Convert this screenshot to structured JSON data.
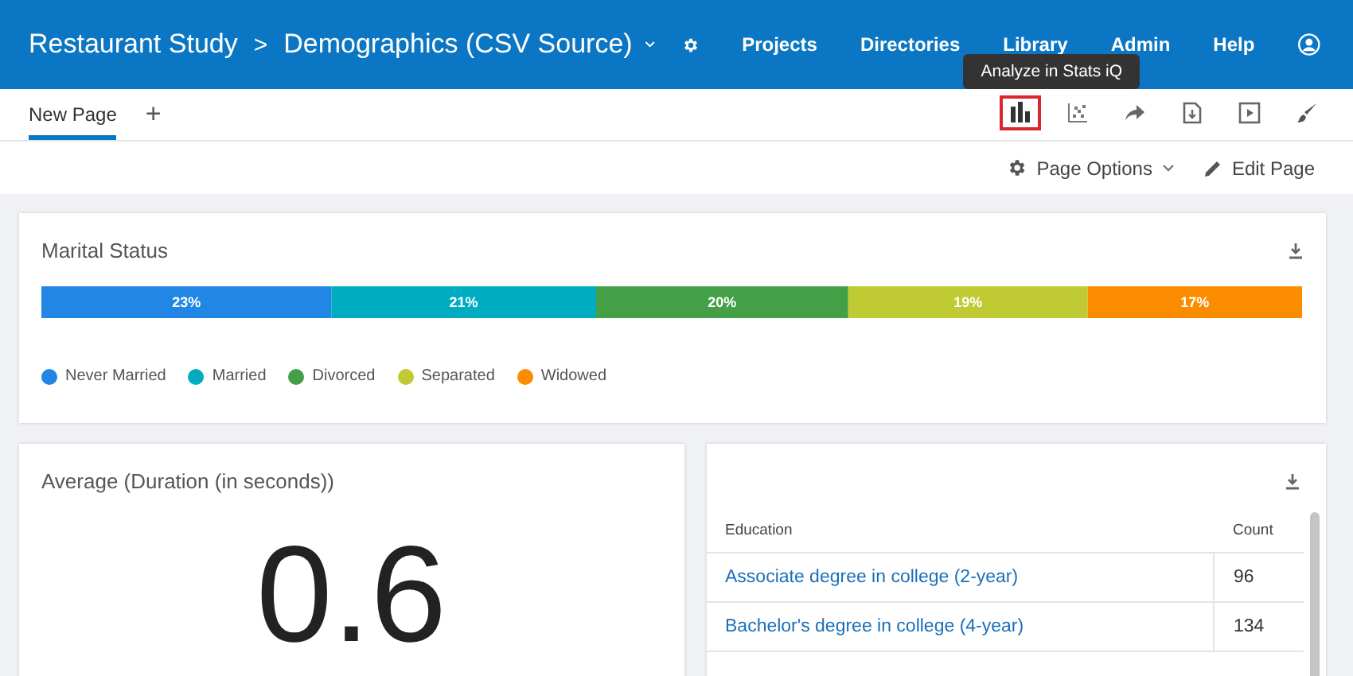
{
  "header": {
    "breadcrumb": [
      "Restaurant Study",
      "Demographics (CSV Source)"
    ],
    "separator": ">",
    "nav": [
      "Projects",
      "Directories",
      "Library",
      "Admin",
      "Help"
    ]
  },
  "tabs": [
    {
      "label": "New Page",
      "selected": true
    }
  ],
  "add_tab": "+",
  "tooltip": "Analyze in Stats iQ",
  "toolbar": [
    {
      "kind": "bar-chart",
      "selected": true
    },
    {
      "kind": "scatter",
      "selected": false
    },
    {
      "kind": "share",
      "selected": false
    },
    {
      "kind": "export",
      "selected": false
    },
    {
      "kind": "present",
      "selected": false
    },
    {
      "kind": "brush",
      "selected": false
    }
  ],
  "page_actions": [
    "Page Options",
    "Edit Page"
  ],
  "marital": {
    "title": "Marital Status",
    "chart_data": {
      "type": "bar",
      "stacked": true,
      "orientation": "horizontal",
      "series": [
        {
          "name": "Never Married",
          "color": "#2186e4",
          "values": [
            23
          ],
          "value_labels": [
            "23%"
          ]
        },
        {
          "name": "Married",
          "color": "#00acc1",
          "values": [
            21
          ],
          "value_labels": [
            "21%"
          ]
        },
        {
          "name": "Divorced",
          "color": "#43a047",
          "values": [
            20
          ],
          "value_labels": [
            "20%"
          ]
        },
        {
          "name": "Separated",
          "color": "#c0ca33",
          "values": [
            19
          ],
          "value_labels": [
            "19%"
          ]
        },
        {
          "name": "Widowed",
          "color": "#fb8c00",
          "values": [
            17
          ],
          "value_labels": [
            "17%"
          ]
        }
      ]
    }
  },
  "average": {
    "title": "Average (Duration (in seconds))",
    "value": "0.6"
  },
  "education": {
    "columns": [
      "Education",
      "Count"
    ],
    "rows": [
      {
        "label": "Associate degree in college (2-year)",
        "count": "96"
      },
      {
        "label": "Bachelor's degree in college (4-year)",
        "count": "134"
      }
    ]
  }
}
